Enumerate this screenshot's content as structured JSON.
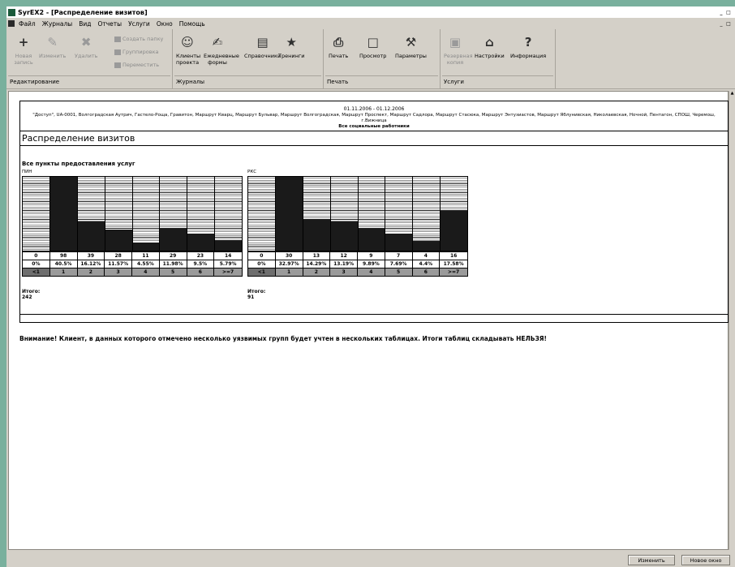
{
  "window": {
    "title": "SyrEX2 - [Распределение визитов]"
  },
  "menu": [
    "Файл",
    "Журналы",
    "Вид",
    "Отчеты",
    "Услуги",
    "Окно",
    "Помощь"
  ],
  "ribbon": {
    "groups": [
      "Редактирование",
      "Журналы",
      "Печать",
      "Услуги"
    ],
    "new_record": "Новая запись",
    "edit": "Изменить",
    "delete": "Удалить",
    "create_folder": "Создать папку",
    "group": "Группировка",
    "move": "Переместить",
    "project_clients": "Клиенты проекта",
    "daily_forms": "Ежедневные формы",
    "references": "Справочники",
    "trainings": "Тренинги",
    "print": "Печать",
    "preview": "Просмотр",
    "params": "Параметры",
    "backup": "Резервная копия",
    "settings": "Настройки",
    "info": "Информация"
  },
  "report": {
    "date_range": "01.11.2006 - 01.12.2006",
    "filter": "\"Доступ\", UA-0001, Волгоградская Аутрич, Гастело-Роща, Гравитон, Маршрут Кварц, Маршрут Бульвар, Маршрут Волгоградская, Маршрут Проспект, Маршрут Садлора, Маршрут Стасюка, Маршрут Энтузиастов, Маршрут Яблунивская, Николаевская, Ночной, Пентагон, СПОШ, Черемош, г.Вижница",
    "subtitle": "Все социальные работники",
    "title": "Распределение визитов",
    "section": "Все пункты предоставления услуг"
  },
  "chart_data": [
    {
      "type": "bar",
      "title": "ПИН",
      "categories": [
        "<1",
        "1",
        "2",
        "3",
        "4",
        "5",
        "6",
        ">=7"
      ],
      "values": [
        0,
        98,
        39,
        28,
        11,
        29,
        23,
        14
      ],
      "percents": [
        "0%",
        "40.5%",
        "16.12%",
        "11.57%",
        "4.55%",
        "11.98%",
        "9.5%",
        "5.79%"
      ],
      "total": "Итого: 242"
    },
    {
      "type": "bar",
      "title": "РКС",
      "categories": [
        "<1",
        "1",
        "2",
        "3",
        "4",
        "5",
        "6",
        ">=7"
      ],
      "values": [
        0,
        30,
        13,
        12,
        9,
        7,
        4,
        16
      ],
      "percents": [
        "0%",
        "32.97%",
        "14.29%",
        "13.19%",
        "9.89%",
        "7.69%",
        "4.4%",
        "17.58%"
      ],
      "total": "Итого: 91"
    }
  ],
  "warning": "Внимание! Клиент, в данных которого отмечено несколько уязвимых групп будет учтен в нескольких таблицах. Итоги таблиц складывать НЕЛЬЗЯ!",
  "status": {
    "change_btn": "Изменить",
    "new_window_btn": "Новое окно"
  },
  "colors": {
    "desktop": "#79b09d",
    "chrome": "#d4d0c8",
    "bar_fill": "#1a1a1a"
  }
}
